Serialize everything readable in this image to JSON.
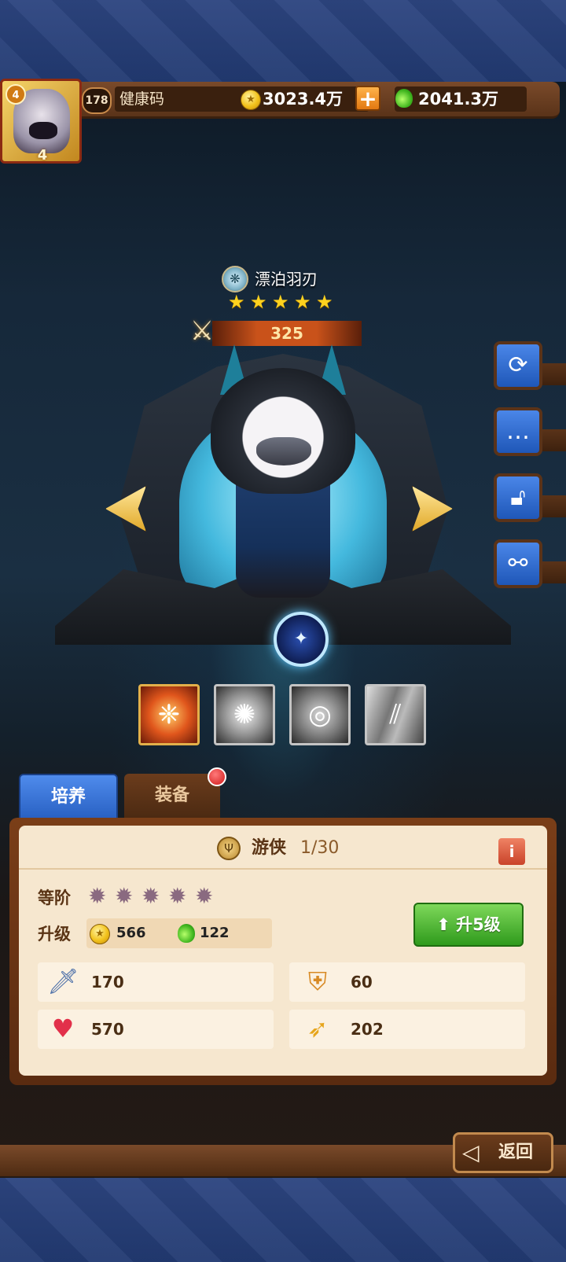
{
  "player": {
    "avatar_rank": "4",
    "avatar_vip": "4",
    "level": "178",
    "name": "健康码"
  },
  "resources": {
    "gold": "3023.4万",
    "potion": "2041.3万",
    "plus_label": "+"
  },
  "hero": {
    "name": "漂泊羽刃",
    "stars": 5,
    "power": "325"
  },
  "side_buttons": [
    "refresh-icon",
    "chat-icon",
    "unlock-icon",
    "share-icon"
  ],
  "skills": [
    "flame-wing-skill",
    "fire-skill",
    "ring-skill",
    "slash-skill"
  ],
  "tabs": {
    "train": "培养",
    "equip": "装备"
  },
  "panel": {
    "class_name": "游侠",
    "class_level": "1/30",
    "info_label": "i",
    "rank_label": "等阶",
    "rank_stars": 5,
    "upgrade_label": "升级",
    "cost_gold": "566",
    "cost_potion": "122",
    "levelup_button": "升5级",
    "stats": {
      "attack": "170",
      "defense": "60",
      "hp": "570",
      "speed": "202"
    }
  },
  "back_button": "返回",
  "colors": {
    "tab_active": "#2860c2",
    "levelup_green": "#2f9a1c",
    "panel_bg": "#f6e7cf"
  }
}
